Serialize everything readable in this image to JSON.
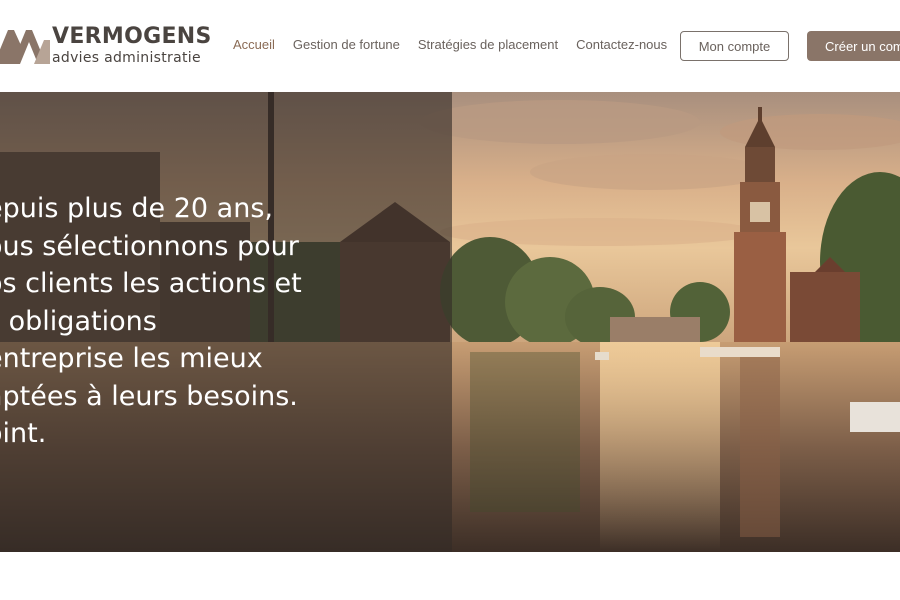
{
  "brand": {
    "name": "VERMOGENS",
    "tagline": "advies administratie",
    "logo_icon": "mountain-peaks-logo",
    "color": "#8a7568"
  },
  "nav": {
    "items": [
      {
        "label": "Accueil",
        "active": true
      },
      {
        "label": "Gestion de fortune",
        "active": false
      },
      {
        "label": "Stratégies de placement",
        "active": false
      },
      {
        "label": "Contactez-nous",
        "active": false
      }
    ],
    "account_label": "Mon compte",
    "create_label": "Créer un com"
  },
  "hero": {
    "lines": [
      "epuis plus de 20 ans,",
      "ous sélectionnons pour",
      "os clients les actions et",
      "s obligations",
      "entreprise les mieux",
      "aptées à leurs besoins.",
      "oint."
    ],
    "image": "amsterdam-canal-sunset-photo"
  }
}
